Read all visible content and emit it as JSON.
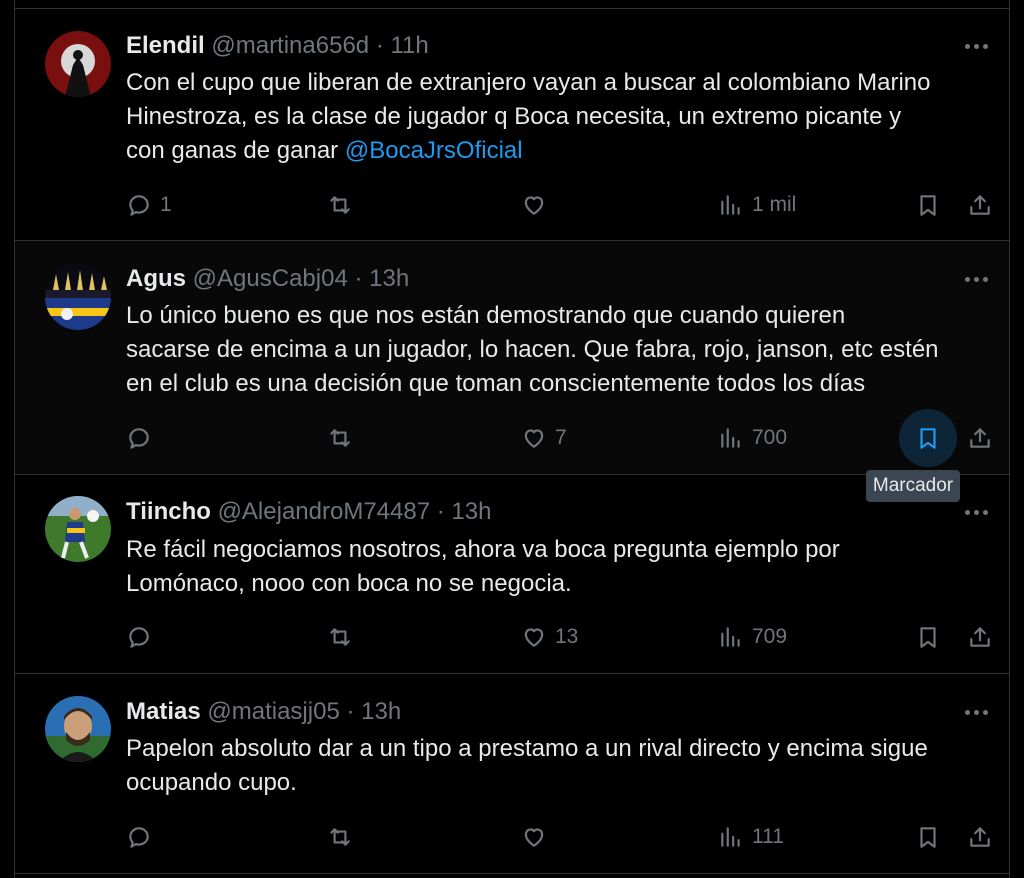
{
  "posts": [
    {
      "display_name": "Elendil",
      "handle": "@martina656d",
      "separator": "·",
      "time": "11h",
      "text_lines": [
        "Con el cupo que liberan de extranjero vayan a buscar al colombiano Marino",
        "Hinestroza, es la clase de jugador q Boca necesita, un extremo picante y",
        "con ganas de ganar "
      ],
      "mention": "@BocaJrsOficial",
      "replies": "1",
      "reposts": "",
      "likes": "",
      "views": "1 mil"
    },
    {
      "display_name": "Agus",
      "handle": "@AgusCabj04",
      "separator": "·",
      "time": "13h",
      "text_lines": [
        "Lo único bueno es que nos están demostrando que cuando quieren",
        "sacarse de encima a un jugador, lo hacen. Que fabra, rojo, janson, etc estén",
        "en el club es una decisión que toman conscientemente todos los días"
      ],
      "replies": "",
      "reposts": "",
      "likes": "7",
      "views": "700"
    },
    {
      "display_name": "Tiincho",
      "handle": "@AlejandroM74487",
      "separator": "·",
      "time": "13h",
      "text_lines": [
        "Re fácil negociamos nosotros, ahora va boca pregunta ejemplo por",
        "Lomónaco, nooo con boca no se negocia."
      ],
      "replies": "",
      "reposts": "",
      "likes": "13",
      "views": "709"
    },
    {
      "display_name": "Matias",
      "handle": "@matiasjj05",
      "separator": "·",
      "time": "13h",
      "text_lines": [
        "Papelon absoluto dar a un tipo a prestamo a un rival directo y encima sigue",
        "ocupando cupo."
      ],
      "replies": "",
      "reposts": "",
      "likes": "",
      "views": "111"
    }
  ],
  "tooltip": "Marcador",
  "icons": {
    "reply": "reply-icon",
    "repost": "repost-icon",
    "like": "heart-icon",
    "views": "views-icon",
    "bookmark": "bookmark-icon",
    "share": "share-icon",
    "more": "more-icon"
  },
  "colors": {
    "background": "#000000",
    "text": "#e7e9ea",
    "muted": "#71767b",
    "accent": "#1d9bf0",
    "divider": "#2f3336"
  }
}
